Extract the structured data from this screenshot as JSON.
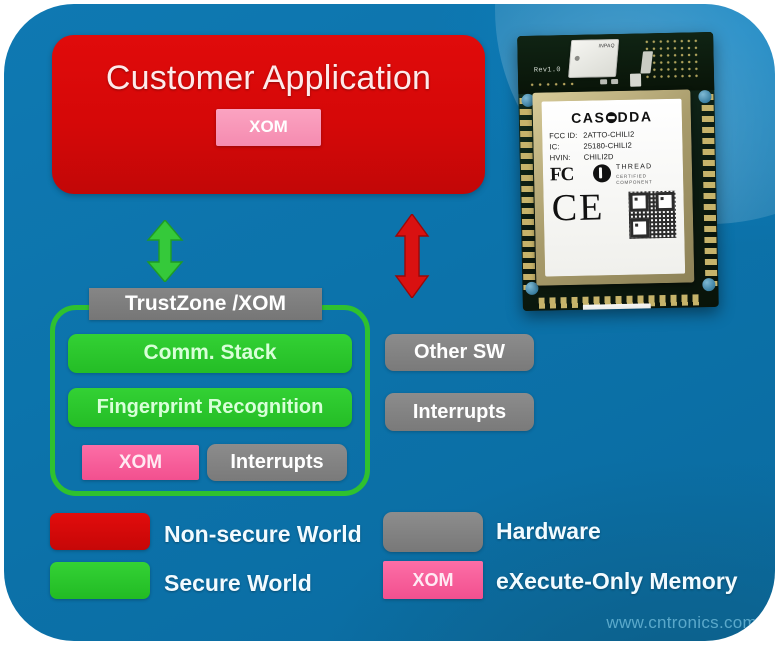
{
  "diagram": {
    "title_box": {
      "label": "Customer Application",
      "badge": "XOM"
    },
    "trustzone": {
      "header": "TrustZone /XOM",
      "items": [
        "Comm. Stack",
        "Fingerprint Recognition"
      ],
      "bottom_row": [
        "XOM",
        "Interrupts"
      ]
    },
    "right_column": [
      "Other  SW",
      "Interrupts"
    ],
    "arrows": [
      {
        "name": "secure-link-arrow",
        "color": "#2fc12f",
        "direction": "bidirectional"
      },
      {
        "name": "nonsecure-link-arrow",
        "color": "#d91111",
        "direction": "bidirectional"
      }
    ]
  },
  "legend": {
    "items": [
      {
        "swatch": "red",
        "color": "#dc0a0a",
        "label": "Non-secure World",
        "badge": ""
      },
      {
        "swatch": "green",
        "color": "#29c72b",
        "label": "Secure World",
        "badge": ""
      },
      {
        "swatch": "gray",
        "color": "#828282",
        "label": "Hardware",
        "badge": ""
      },
      {
        "swatch": "pink",
        "color": "#f75c9b",
        "label": "eXecute-Only  Memory",
        "badge": "XOM"
      }
    ]
  },
  "module_photo": {
    "brand": "CAS",
    "brand_tail": "DDA",
    "rev": "Rev1.0",
    "xtal_mark": "INPAQ",
    "fcc_id_key": "FCC ID:",
    "fcc_id_val": "2ATTO-CHILI2",
    "ic_key": "IC:",
    "ic_val": "25180-CHILI2",
    "hvin_key": "HVIN:",
    "hvin_val": "CHILI2D",
    "fcc_logo": "FC",
    "thread_name": "THREAD",
    "thread_sub1": "CERTIFIED",
    "thread_sub2": "COMPONENT",
    "ce_mark": "CE"
  },
  "watermark": {
    "text": "www.cntronics.com"
  },
  "colors": {
    "background_blue": "#0c73ab",
    "nonsecure_red": "#dc0a0a",
    "secure_green": "#29c72b",
    "hardware_gray": "#828282",
    "xom_pink": "#f75c9b"
  }
}
